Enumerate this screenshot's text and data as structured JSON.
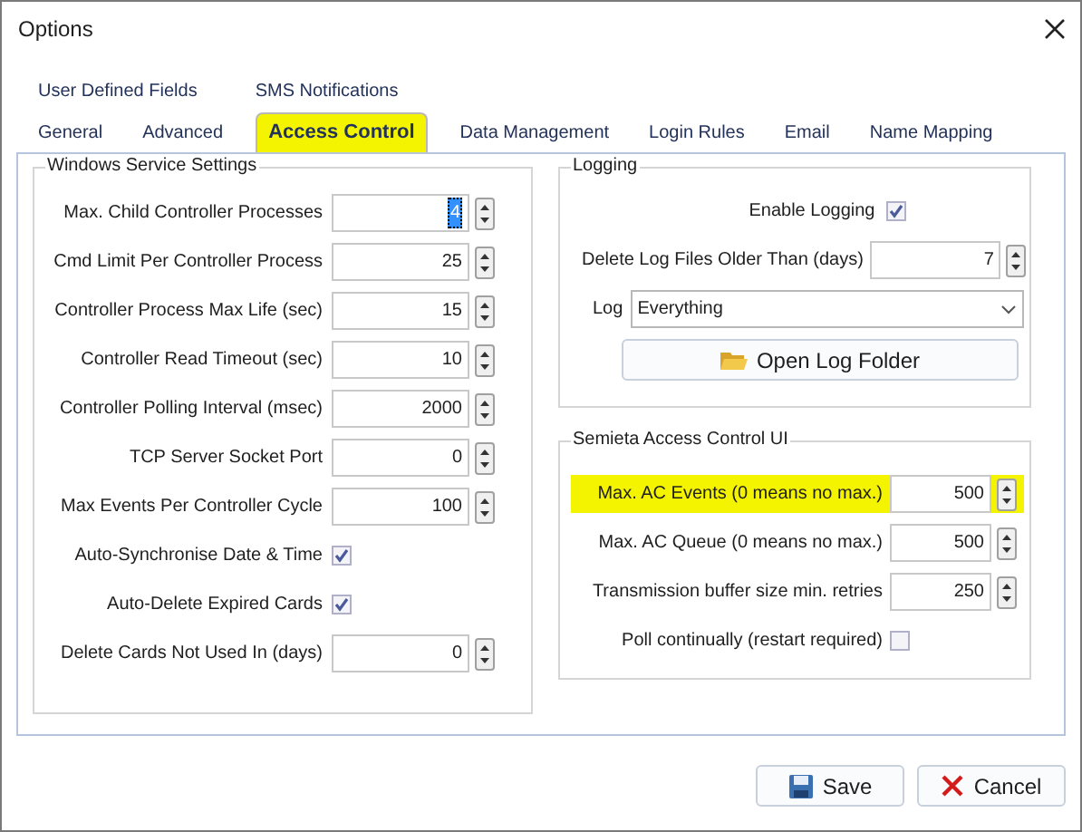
{
  "window": {
    "title": "Options"
  },
  "tab_rows": [
    [
      {
        "label": "User Defined Fields",
        "selected": false,
        "highlighted": false
      },
      {
        "label": "SMS Notifications",
        "selected": false,
        "highlighted": false
      }
    ],
    [
      {
        "label": "General",
        "selected": false,
        "highlighted": false
      },
      {
        "label": "Advanced",
        "selected": false,
        "highlighted": false
      },
      {
        "label": "Access Control",
        "selected": true,
        "highlighted": true
      },
      {
        "label": "Data Management",
        "selected": false,
        "highlighted": false
      },
      {
        "label": "Login Rules",
        "selected": false,
        "highlighted": false
      },
      {
        "label": "Email",
        "selected": false,
        "highlighted": false
      },
      {
        "label": "Name Mapping",
        "selected": false,
        "highlighted": false
      }
    ]
  ],
  "windows_service": {
    "title": "Windows Service Settings",
    "rows": [
      {
        "kind": "spin",
        "label": "Max. Child Controller Processes",
        "value": "4",
        "text_selected": true
      },
      {
        "kind": "spin",
        "label": "Cmd Limit Per Controller Process",
        "value": "25",
        "text_selected": false
      },
      {
        "kind": "spin",
        "label": "Controller Process Max Life (sec)",
        "value": "15",
        "text_selected": false
      },
      {
        "kind": "spin",
        "label": "Controller Read Timeout (sec)",
        "value": "10",
        "text_selected": false
      },
      {
        "kind": "spin",
        "label": "Controller Polling Interval (msec)",
        "value": "2000",
        "text_selected": false
      },
      {
        "kind": "spin",
        "label": "TCP Server Socket Port",
        "value": "0",
        "text_selected": false
      },
      {
        "kind": "spin",
        "label": "Max Events Per Controller Cycle",
        "value": "100",
        "text_selected": false
      },
      {
        "kind": "check",
        "label": "Auto-Synchronise Date & Time",
        "checked": true
      },
      {
        "kind": "check",
        "label": "Auto-Delete Expired Cards",
        "checked": true
      },
      {
        "kind": "spin",
        "label": "Delete Cards Not Used In (days)",
        "value": "0",
        "text_selected": false
      }
    ]
  },
  "logging": {
    "title": "Logging",
    "enable_label": "Enable Logging",
    "enable_checked": true,
    "delete_label": "Delete Log Files Older Than (days)",
    "delete_value": "7",
    "log_label": "Log",
    "log_value": "Everything",
    "open_button": "Open Log Folder"
  },
  "semieta": {
    "title": "Semieta Access Control UI",
    "rows": [
      {
        "kind": "spin",
        "label": "Max. AC Events (0 means no max.)",
        "value": "500",
        "highlighted": true
      },
      {
        "kind": "spin",
        "label": "Max. AC Queue (0 means no max.)",
        "value": "500",
        "highlighted": false
      },
      {
        "kind": "spin",
        "label": "Transmission buffer size min. retries",
        "value": "250",
        "highlighted": false
      },
      {
        "kind": "check",
        "label": "Poll continually (restart required)",
        "checked": false,
        "highlighted": false
      }
    ]
  },
  "buttons": [
    {
      "kind": "save",
      "label": "Save"
    },
    {
      "kind": "cancel",
      "label": "Cancel"
    }
  ]
}
